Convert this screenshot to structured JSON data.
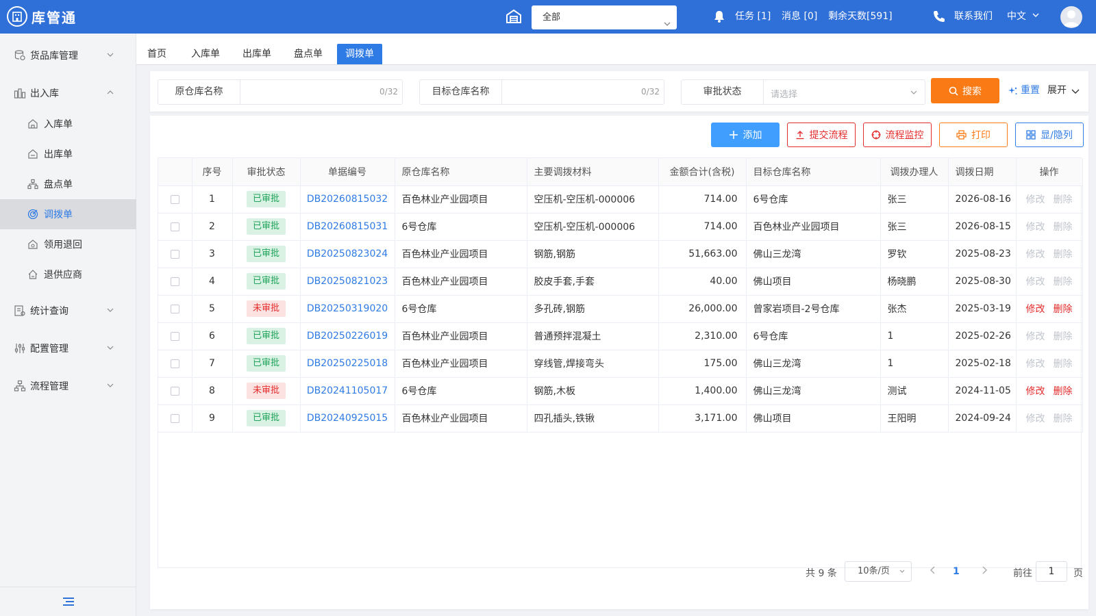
{
  "header": {
    "logo_text": "库管通",
    "warehouse_select": "全部",
    "tasks": "任务 [1]",
    "messages": "消息 [0]",
    "remaining_days": "剩余天数[591]",
    "contact": "联系我们",
    "language": "中文"
  },
  "sidebar": {
    "groups": [
      {
        "label": "货品库管理"
      },
      {
        "label": "出入库"
      },
      {
        "label": "统计查询"
      },
      {
        "label": "配置管理"
      },
      {
        "label": "流程管理"
      }
    ],
    "subitems": [
      {
        "label": "入库单"
      },
      {
        "label": "出库单"
      },
      {
        "label": "盘点单"
      },
      {
        "label": "调拨单"
      },
      {
        "label": "领用退回"
      },
      {
        "label": "退供应商"
      }
    ]
  },
  "tabs": [
    "首页",
    "入库单",
    "出库单",
    "盘点单",
    "调拨单"
  ],
  "search": {
    "source_label": "原仓库名称",
    "source_count": "0/32",
    "target_label": "目标仓库名称",
    "target_count": "0/32",
    "status_label": "审批状态",
    "status_placeholder": "请选择",
    "search_btn": "搜索",
    "reset_btn": "重置",
    "expand_btn": "展开"
  },
  "toolbar": {
    "add": "添加",
    "submit": "提交流程",
    "monitor": "流程监控",
    "print": "打印",
    "columns": "显/隐列"
  },
  "table": {
    "headers": [
      "序号",
      "审批状态",
      "单据编号",
      "原仓库名称",
      "主要调拨材料",
      "金额合计(含税)",
      "目标仓库名称",
      "调拨办理人",
      "调拨日期",
      "操作"
    ],
    "op_edit": "修改",
    "op_delete": "删除",
    "rows": [
      {
        "no": "1",
        "status": "已审批",
        "approved": true,
        "code": "DB20260815032",
        "source": "百色林业产业园项目",
        "material": "空压机-空压机-000006",
        "amount": "714.00",
        "target": "6号仓库",
        "handler": "张三",
        "date": "2026-08-16"
      },
      {
        "no": "2",
        "status": "已审批",
        "approved": true,
        "code": "DB20260815031",
        "source": "6号仓库",
        "material": "空压机-空压机-000006",
        "amount": "714.00",
        "target": "百色林业产业园项目",
        "handler": "张三",
        "date": "2026-08-15"
      },
      {
        "no": "3",
        "status": "已审批",
        "approved": true,
        "code": "DB20250823024",
        "source": "百色林业产业园项目",
        "material": "钢筋,钢筋",
        "amount": "51,663.00",
        "target": "佛山三龙湾",
        "handler": "罗钦",
        "date": "2025-08-23"
      },
      {
        "no": "4",
        "status": "已审批",
        "approved": true,
        "code": "DB20250821023",
        "source": "百色林业产业园项目",
        "material": "胶皮手套,手套",
        "amount": "40.00",
        "target": "佛山项目",
        "handler": "杨晓鹏",
        "date": "2025-08-30"
      },
      {
        "no": "5",
        "status": "未审批",
        "approved": false,
        "code": "DB20250319020",
        "source": "6号仓库",
        "material": "多孔砖,钢筋",
        "amount": "26,000.00",
        "target": "曾家岩项目-2号仓库",
        "handler": "张杰",
        "date": "2025-03-19"
      },
      {
        "no": "6",
        "status": "已审批",
        "approved": true,
        "code": "DB20250226019",
        "source": "百色林业产业园项目",
        "material": "普通预拌混凝土",
        "amount": "2,310.00",
        "target": "6号仓库",
        "handler": "1",
        "date": "2025-02-26"
      },
      {
        "no": "7",
        "status": "已审批",
        "approved": true,
        "code": "DB20250225018",
        "source": "百色林业产业园项目",
        "material": "穿线管,焊接弯头",
        "amount": "175.00",
        "target": "佛山三龙湾",
        "handler": "1",
        "date": "2025-02-18"
      },
      {
        "no": "8",
        "status": "未审批",
        "approved": false,
        "code": "DB20241105017",
        "source": "6号仓库",
        "material": "钢筋,木板",
        "amount": "1,400.00",
        "target": "佛山三龙湾",
        "handler": "测试",
        "date": "2024-11-05"
      },
      {
        "no": "9",
        "status": "已审批",
        "approved": true,
        "code": "DB20240925015",
        "source": "百色林业产业园项目",
        "material": "四孔插头,铁锹",
        "amount": "3,171.00",
        "target": "佛山项目",
        "handler": "王阳明",
        "date": "2024-09-24"
      }
    ]
  },
  "pagination": {
    "total": "共 9 条",
    "page_size": "10条/页",
    "current": "1",
    "goto_label": "前往",
    "goto_value": "1",
    "page_suffix": "页"
  },
  "colors": {
    "primary": "#2f6fd8",
    "accent_orange": "#fa7b15",
    "danger": "#e42b2b",
    "link": "#2f7be5"
  }
}
